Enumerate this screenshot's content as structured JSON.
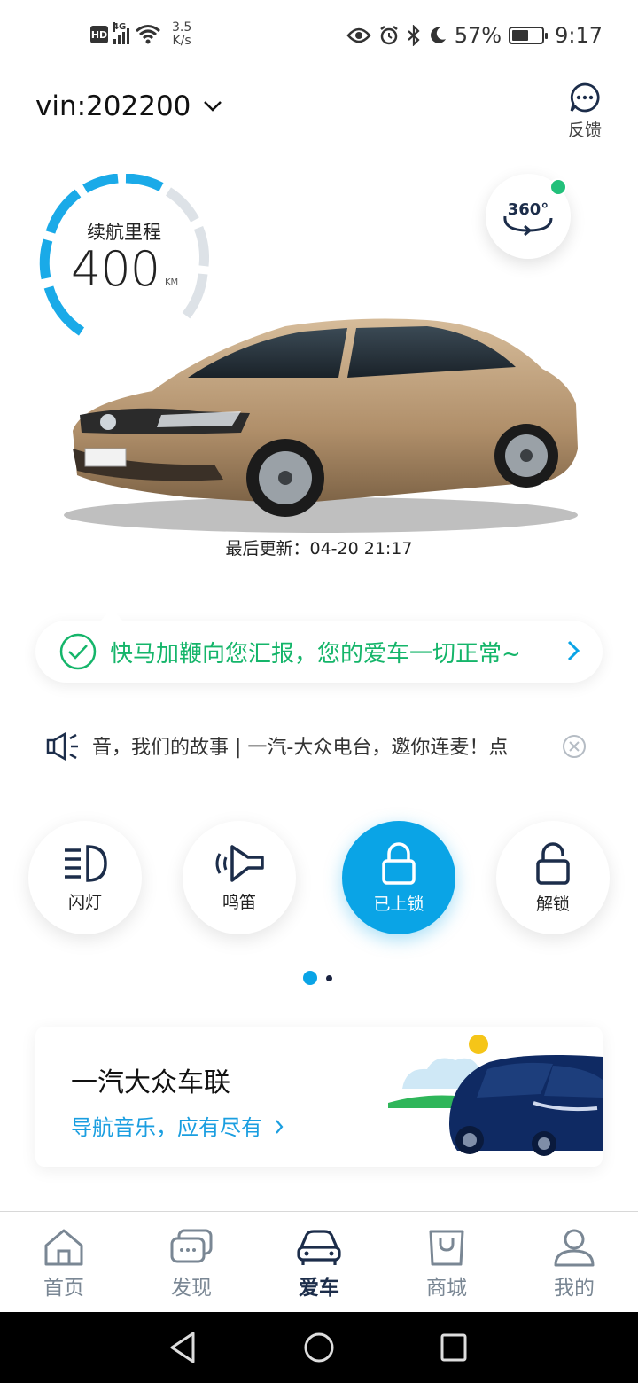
{
  "status_bar": {
    "network_type": "4G",
    "hd_label": "HD",
    "speed_value": "3.5",
    "speed_unit": "K/s",
    "battery": "57%",
    "battery_level": 0.57,
    "time": "9:17"
  },
  "header": {
    "vin": "vin:202200",
    "feedback_label": "反馈"
  },
  "range": {
    "title": "续航里程",
    "value": "400",
    "unit": "KM"
  },
  "view_360_label": "360°",
  "last_update": "最后更新：04-20 21:17",
  "status_message": "快马加鞭向您汇报，您的爱车一切正常~",
  "radio_ticker": "音，我们的故事 | 一汽-大众电台，邀你连麦！点",
  "controls": [
    {
      "label": "闪灯",
      "active": false
    },
    {
      "label": "鸣笛",
      "active": false
    },
    {
      "label": "已上锁",
      "active": true
    },
    {
      "label": "解锁",
      "active": false
    }
  ],
  "promo": {
    "title": "一汽大众车联",
    "subtitle": "导航音乐，应有尽有"
  },
  "bottom_nav": [
    {
      "label": "首页",
      "icon": "home-icon",
      "active": false
    },
    {
      "label": "发现",
      "icon": "discover-icon",
      "active": false
    },
    {
      "label": "爱车",
      "icon": "car-icon",
      "active": true
    },
    {
      "label": "商城",
      "icon": "shop-icon",
      "active": false
    },
    {
      "label": "我的",
      "icon": "profile-icon",
      "active": false
    }
  ],
  "colors": {
    "accent_blue": "#0aa4e6",
    "ok_green": "#15b56a",
    "nav_active": "#1c2d4a",
    "nav_inactive": "#7a8794"
  }
}
